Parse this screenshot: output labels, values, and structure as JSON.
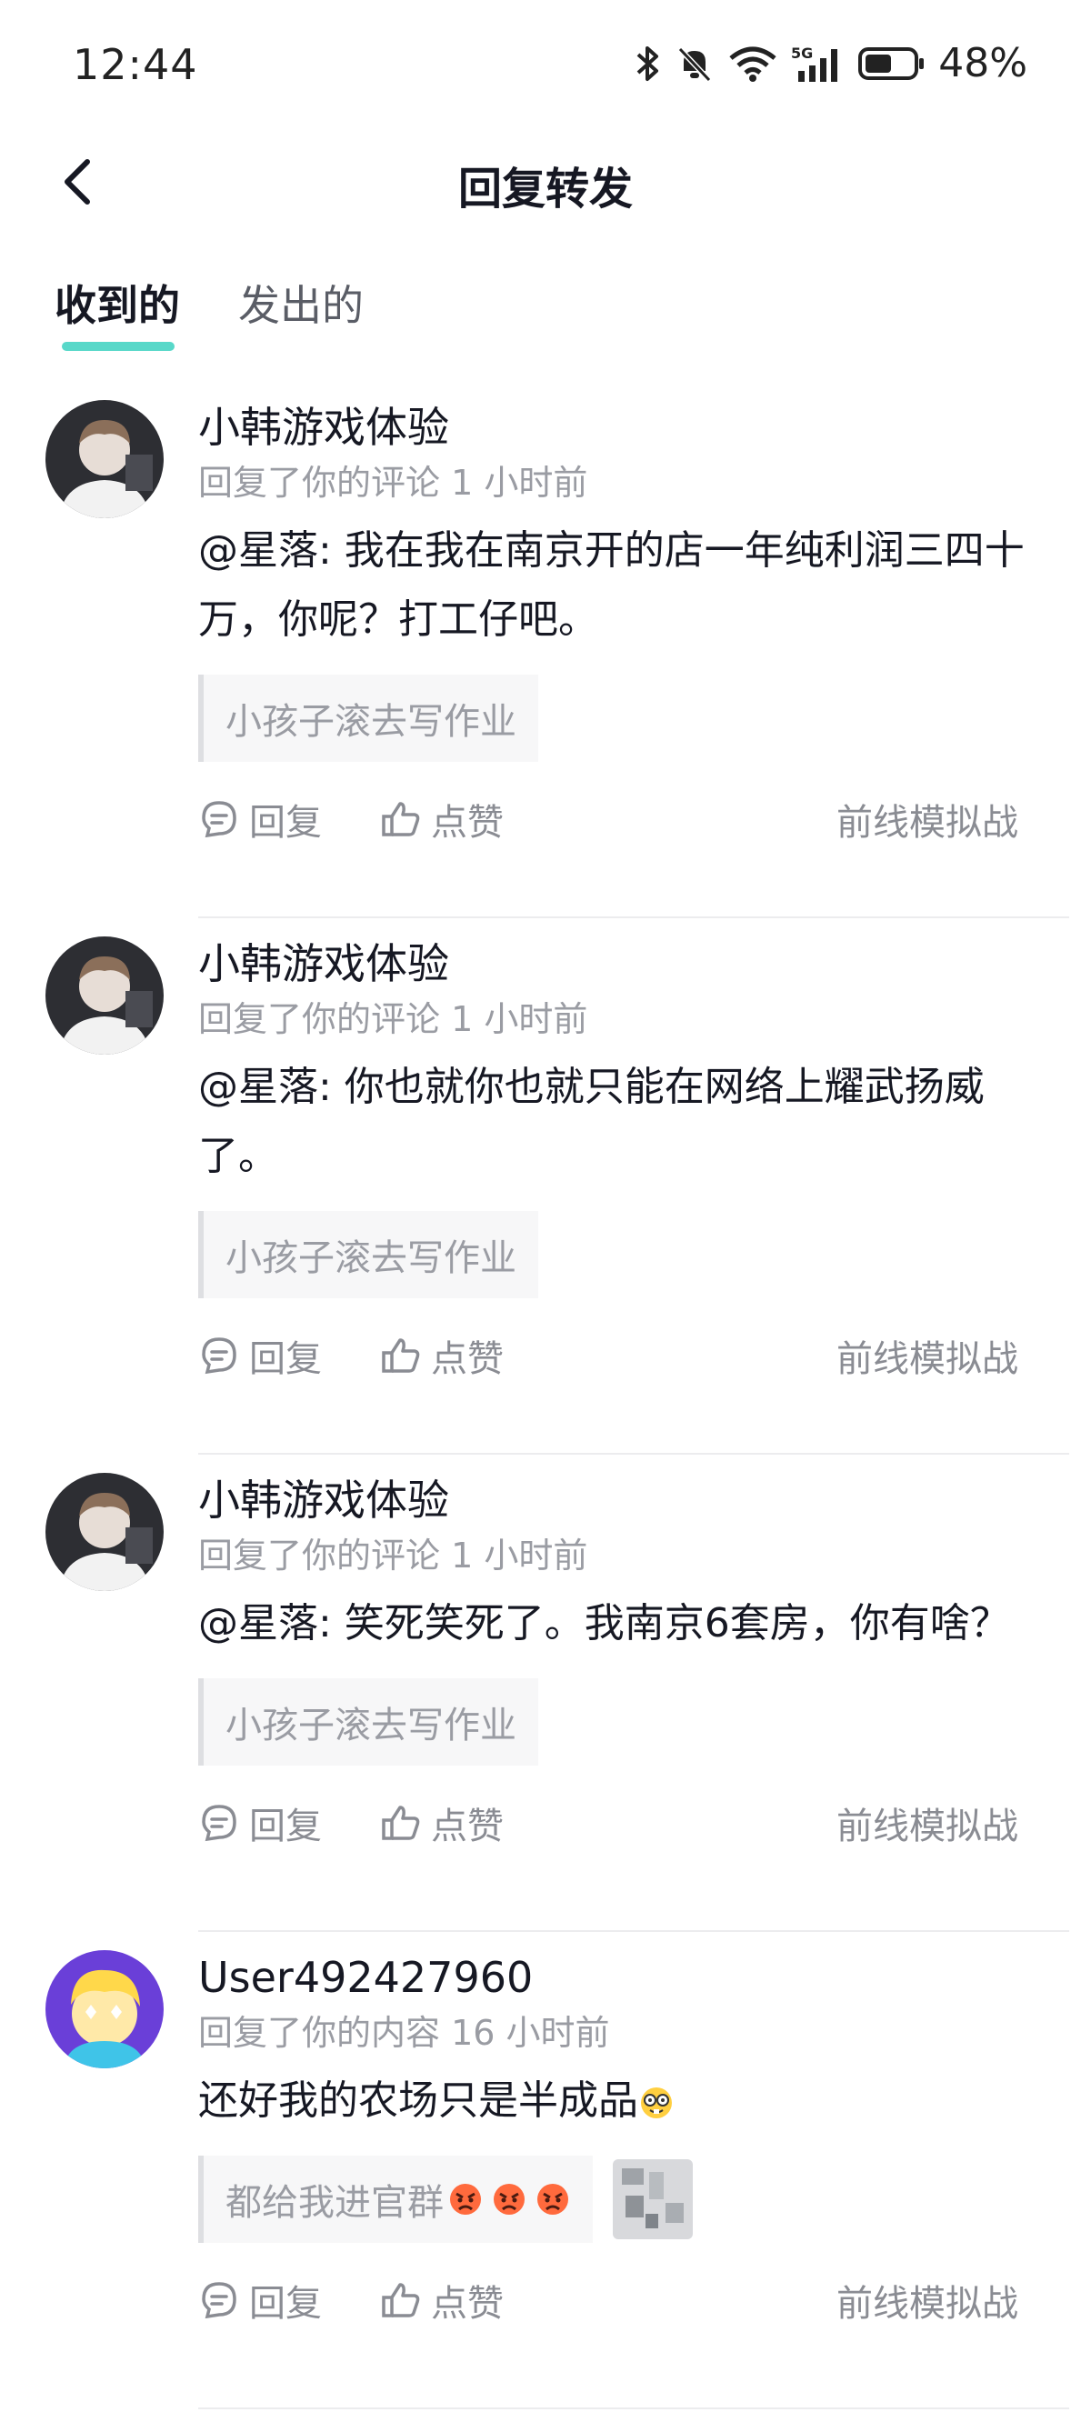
{
  "status_bar": {
    "time": "12:44",
    "battery": "48%",
    "icons": [
      "bluetooth-icon",
      "mute-bell-icon",
      "wifi-icon",
      "5g-signal-icon",
      "battery-icon"
    ]
  },
  "nav": {
    "title": "回复转发",
    "back_icon": "chevron-left-icon"
  },
  "tabs": [
    {
      "label": "收到的",
      "active": true
    },
    {
      "label": "发出的",
      "active": false
    }
  ],
  "items": [
    {
      "name": "小韩游戏体验",
      "meta": "回复了你的评论 1 小时前",
      "text": "@星落: 我在我在南京开的店一年纯利润三四十万，你呢？打工仔吧。",
      "quote": "小孩子滚去写作业",
      "reply": "回复",
      "like": "点赞",
      "source": "前线模拟战"
    },
    {
      "name": "小韩游戏体验",
      "meta": "回复了你的评论 1 小时前",
      "text": "@星落: 你也就你也就只能在网络上耀武扬威了。",
      "quote": "小孩子滚去写作业",
      "reply": "回复",
      "like": "点赞",
      "source": "前线模拟战"
    },
    {
      "name": "小韩游戏体验",
      "meta": "回复了你的评论 1 小时前",
      "text": "@星落: 笑死笑死了。我南京6套房，你有啥？",
      "quote": "小孩子滚去写作业",
      "reply": "回复",
      "like": "点赞",
      "source": "前线模拟战"
    },
    {
      "name": "User492427960",
      "meta": "回复了你的内容 16 小时前",
      "text": "还好我的农场只是半成品",
      "quote": "都给我进官群",
      "reply": "回复",
      "like": "点赞",
      "source": "前线模拟战"
    }
  ],
  "colors": {
    "accent": "#3bd1c0",
    "text_primary": "#161823",
    "text_secondary": "#9a9ca3"
  }
}
